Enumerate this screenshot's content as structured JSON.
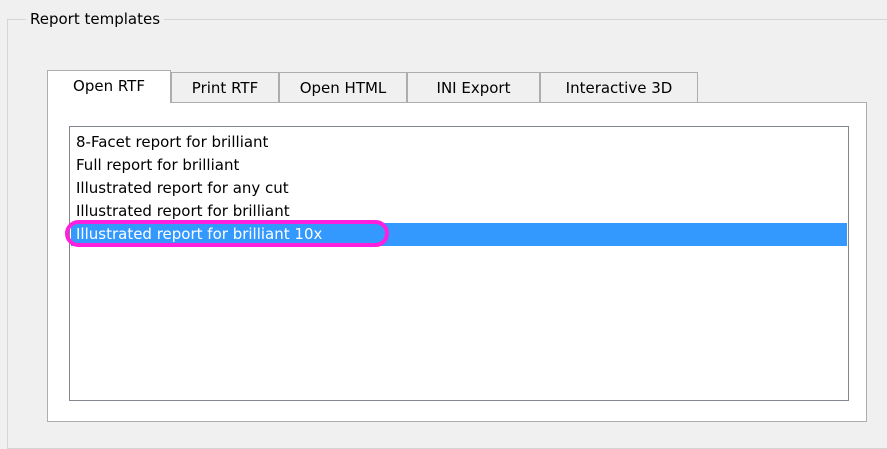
{
  "groupbox": {
    "title": "Report templates"
  },
  "tabs": [
    {
      "label": "Open RTF",
      "active": true
    },
    {
      "label": "Print RTF",
      "active": false
    },
    {
      "label": "Open HTML",
      "active": false
    },
    {
      "label": "INI Export",
      "active": false
    },
    {
      "label": "Interactive 3D",
      "active": false
    }
  ],
  "list": {
    "items": [
      {
        "label": "8-Facet report for brilliant",
        "selected": false
      },
      {
        "label": "Full report for brilliant",
        "selected": false
      },
      {
        "label": "Illustrated report for any cut",
        "selected": false
      },
      {
        "label": "Illustrated report for brilliant",
        "selected": false
      },
      {
        "label": "Illustrated report for brilliant 10x",
        "selected": true
      }
    ],
    "selection_color": "#3399ff",
    "highlight_color": "#ff1fdc"
  }
}
